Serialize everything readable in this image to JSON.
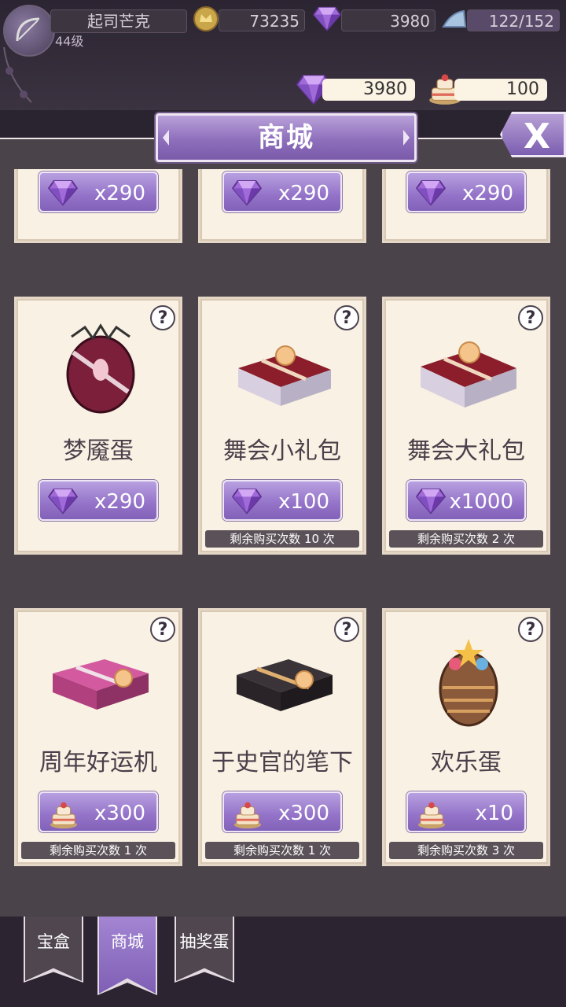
{
  "player": {
    "name": "起司芒克",
    "level": "44级"
  },
  "stats": {
    "gold": "73235",
    "gems": "3980",
    "stamina": "122/152"
  },
  "currency": {
    "gems": "3980",
    "cakes": "100"
  },
  "header": {
    "title": "商城",
    "close_label": "X"
  },
  "colors": {
    "accent": "#9372c8",
    "card_bg": "#f9f1e3",
    "panel_bg": "#4a4349"
  },
  "partial_row": [
    {
      "price": "x290",
      "currency_icon": "gem-icon"
    },
    {
      "price": "x290",
      "currency_icon": "gem-icon"
    },
    {
      "price": "x290",
      "currency_icon": "gem-icon"
    }
  ],
  "items": [
    {
      "name": "梦魇蛋",
      "price": "x290",
      "currency_icon": "gem-icon",
      "remaining": "",
      "art_icon": "dark-egg-icon"
    },
    {
      "name": "舞会小礼包",
      "price": "x100",
      "currency_icon": "gem-icon",
      "remaining": "剩余购买次数 10 次",
      "art_icon": "red-gift-box-icon"
    },
    {
      "name": "舞会大礼包",
      "price": "x1000",
      "currency_icon": "gem-icon",
      "remaining": "剩余购买次数 2 次",
      "art_icon": "red-gift-box-icon"
    },
    {
      "name": "周年好运机",
      "price": "x300",
      "currency_icon": "cake-icon",
      "remaining": "剩余购买次数 1 次",
      "art_icon": "pink-gift-box-icon"
    },
    {
      "name": "于史官的笔下",
      "price": "x300",
      "currency_icon": "cake-icon",
      "remaining": "剩余购买次数 1 次",
      "art_icon": "black-gift-box-icon"
    },
    {
      "name": "欢乐蛋",
      "price": "x10",
      "currency_icon": "cake-icon",
      "remaining": "剩余购买次数 3 次",
      "art_icon": "festive-egg-icon"
    }
  ],
  "help_label": "?",
  "tabs": [
    {
      "label": "宝盒",
      "active": false
    },
    {
      "label": "商城",
      "active": true
    },
    {
      "label": "抽奖蛋",
      "active": false
    }
  ]
}
